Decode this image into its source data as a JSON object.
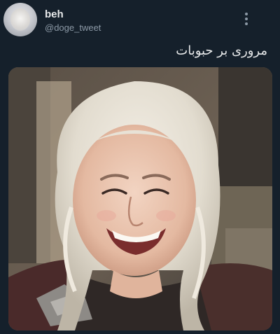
{
  "author": {
    "display_name": "beh",
    "handle": "@doge_tweet"
  },
  "tweet": {
    "text": "مروری بر حبوبات"
  },
  "icons": {
    "menu": "more-vertical-icon"
  },
  "colors": {
    "background": "#15202b",
    "primary_text": "#e7e9ea",
    "secondary_text": "#8b98a5"
  }
}
